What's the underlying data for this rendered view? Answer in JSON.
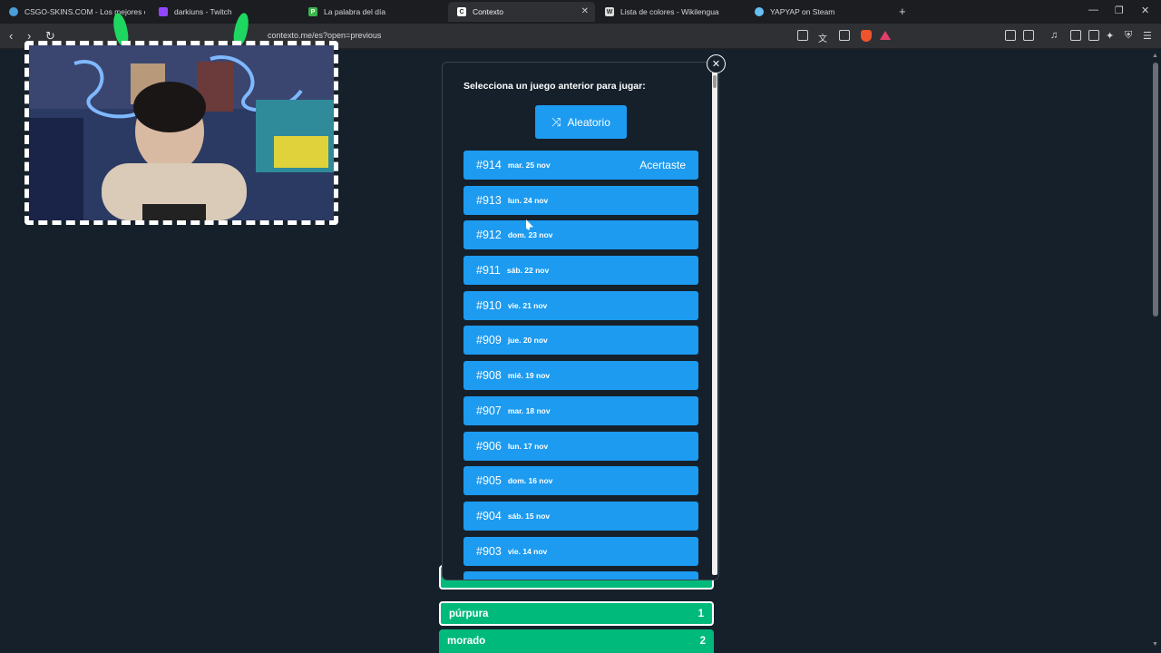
{
  "browser": {
    "tabs": [
      {
        "title": "CSGO-SKINS.COM - Los mejores ca",
        "favicon_color": "#4a9fd8"
      },
      {
        "title": "darkiuns - Twitch",
        "favicon_color": "#9146ff"
      },
      {
        "title": "La palabra del día",
        "favicon_color": "#3bb54a"
      },
      {
        "title": "Contexto",
        "favicon_color": "#ffffff"
      },
      {
        "title": "Lista de colores - Wikilengua",
        "favicon_color": "#dddddd"
      },
      {
        "title": "YAPYAP on Steam",
        "favicon_color": "#66c0f4"
      }
    ],
    "url": "contexto.me/es?open=previous"
  },
  "modal": {
    "title": "Selecciona un juego anterior para jugar:",
    "random_label": "Aleatorio",
    "games": [
      {
        "num": "#914",
        "date": "mar. 25 nov",
        "status": "Acertaste"
      },
      {
        "num": "#913",
        "date": "lun. 24 nov",
        "status": ""
      },
      {
        "num": "#912",
        "date": "dom. 23 nov",
        "status": ""
      },
      {
        "num": "#911",
        "date": "sáb. 22 nov",
        "status": ""
      },
      {
        "num": "#910",
        "date": "vie. 21 nov",
        "status": ""
      },
      {
        "num": "#909",
        "date": "jue. 20 nov",
        "status": ""
      },
      {
        "num": "#908",
        "date": "mié. 19 nov",
        "status": ""
      },
      {
        "num": "#907",
        "date": "mar. 18 nov",
        "status": ""
      },
      {
        "num": "#906",
        "date": "lun. 17 nov",
        "status": ""
      },
      {
        "num": "#905",
        "date": "dom. 16 nov",
        "status": ""
      },
      {
        "num": "#904",
        "date": "sáb. 15 nov",
        "status": ""
      },
      {
        "num": "#903",
        "date": "vie. 14 nov",
        "status": ""
      },
      {
        "num": "",
        "date": "",
        "status": ""
      }
    ]
  },
  "words": [
    {
      "word": "púrpura",
      "rank": "1"
    },
    {
      "word": "morado",
      "rank": "2"
    }
  ],
  "colors": {
    "accent_blue": "#1d9bf0",
    "word_green": "#00ba7c",
    "page_bg": "#15202b"
  }
}
